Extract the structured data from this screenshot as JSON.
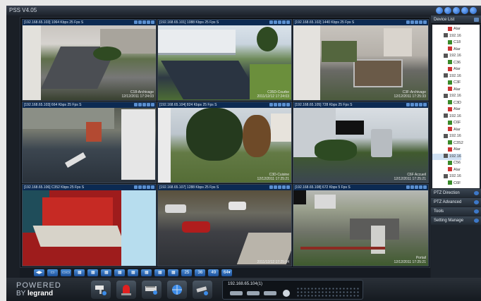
{
  "window": {
    "title": "PSS V4.05"
  },
  "cells": [
    {
      "header": "[192.168.65.103] 1064 Kbps 25 Fps S",
      "caption_name": "C18-Archivage",
      "caption_time": "12/12/2011 17:24:03"
    },
    {
      "header": "[192.168.65.101] 1088 Kbps 25 Fps S",
      "caption_name": "C35D-Courbe",
      "caption_time": "2011/12/12 17:24:03"
    },
    {
      "header": "[192.168.65.102] 1440 Kbps 25 Fps S",
      "caption_name": "C3F-Archivage",
      "caption_time": "12/12/2011 17:25:33"
    },
    {
      "header": "[192.168.65.103] 664 Kbps 25 Fps S",
      "caption_name": "",
      "caption_time": ""
    },
    {
      "header": "[192.168.65.104] 824 Kbps 25 Fps S",
      "caption_name": "C3D-Cuisine",
      "caption_time": "12/12/2011 17:25:21"
    },
    {
      "header": "[192.168.65.105] 728 Kbps 25 Fps S",
      "caption_name": "C6F Accueil",
      "caption_time": "12/12/2011 17:25:21"
    },
    {
      "header": "[192.168.65.106] C352 Kbps 25 Fps S",
      "caption_name": "",
      "caption_time": ""
    },
    {
      "header": "[192.168.65.107] 1288 Kbps 25 Fps S",
      "caption_name": "",
      "caption_time": "2011/12/12 17:25:04"
    },
    {
      "header": "[192.168.65.108] 672 Kbps 5 Fps S",
      "caption_name": "Portail",
      "caption_time": "12/12/2011 17:25:21"
    }
  ],
  "toolbar": {
    "buttons": [
      "◀▶",
      "▭",
      "▭▭",
      "▦",
      "▦",
      "▦",
      "▦",
      "▦",
      "▦",
      "▦",
      "▦",
      "25",
      "36",
      "49",
      "64▾"
    ]
  },
  "branding": {
    "line1": "POWERED",
    "by": "BY",
    "brand": "legrand"
  },
  "device_strip": {
    "label": "192.168.65.104(1)"
  },
  "panel": {
    "device_list_title": "Device List",
    "tree": [
      {
        "text": "Alar",
        "type": "alarm"
      },
      {
        "text": "192.16",
        "type": "device"
      },
      {
        "text": "C18",
        "type": "cam"
      },
      {
        "text": "Alar",
        "type": "alarm"
      },
      {
        "text": "192.16",
        "type": "device"
      },
      {
        "text": "C36",
        "type": "cam"
      },
      {
        "text": "Alar",
        "type": "alarm"
      },
      {
        "text": "192.16",
        "type": "device"
      },
      {
        "text": "C3F",
        "type": "cam"
      },
      {
        "text": "Alar",
        "type": "alarm"
      },
      {
        "text": "192.16",
        "type": "device"
      },
      {
        "text": "C3D",
        "type": "cam"
      },
      {
        "text": "Alar",
        "type": "alarm"
      },
      {
        "text": "192.16",
        "type": "device"
      },
      {
        "text": "C6F",
        "type": "cam"
      },
      {
        "text": "Alar",
        "type": "alarm"
      },
      {
        "text": "192.16",
        "type": "device"
      },
      {
        "text": "C3S2",
        "type": "cam"
      },
      {
        "text": "Alar",
        "type": "alarm"
      },
      {
        "text": "192.16",
        "type": "device",
        "selected": true
      },
      {
        "text": "C56",
        "type": "cam"
      },
      {
        "text": "Alar",
        "type": "alarm"
      },
      {
        "text": "192.16",
        "type": "device"
      },
      {
        "text": "C6F",
        "type": "cam"
      }
    ],
    "sections": [
      "PTZ Direction",
      "PTZ Advanced",
      "Tools",
      "Setting Manage"
    ]
  },
  "colors": {
    "header_bg": "#0c2a52",
    "accent": "#2f74cf"
  }
}
